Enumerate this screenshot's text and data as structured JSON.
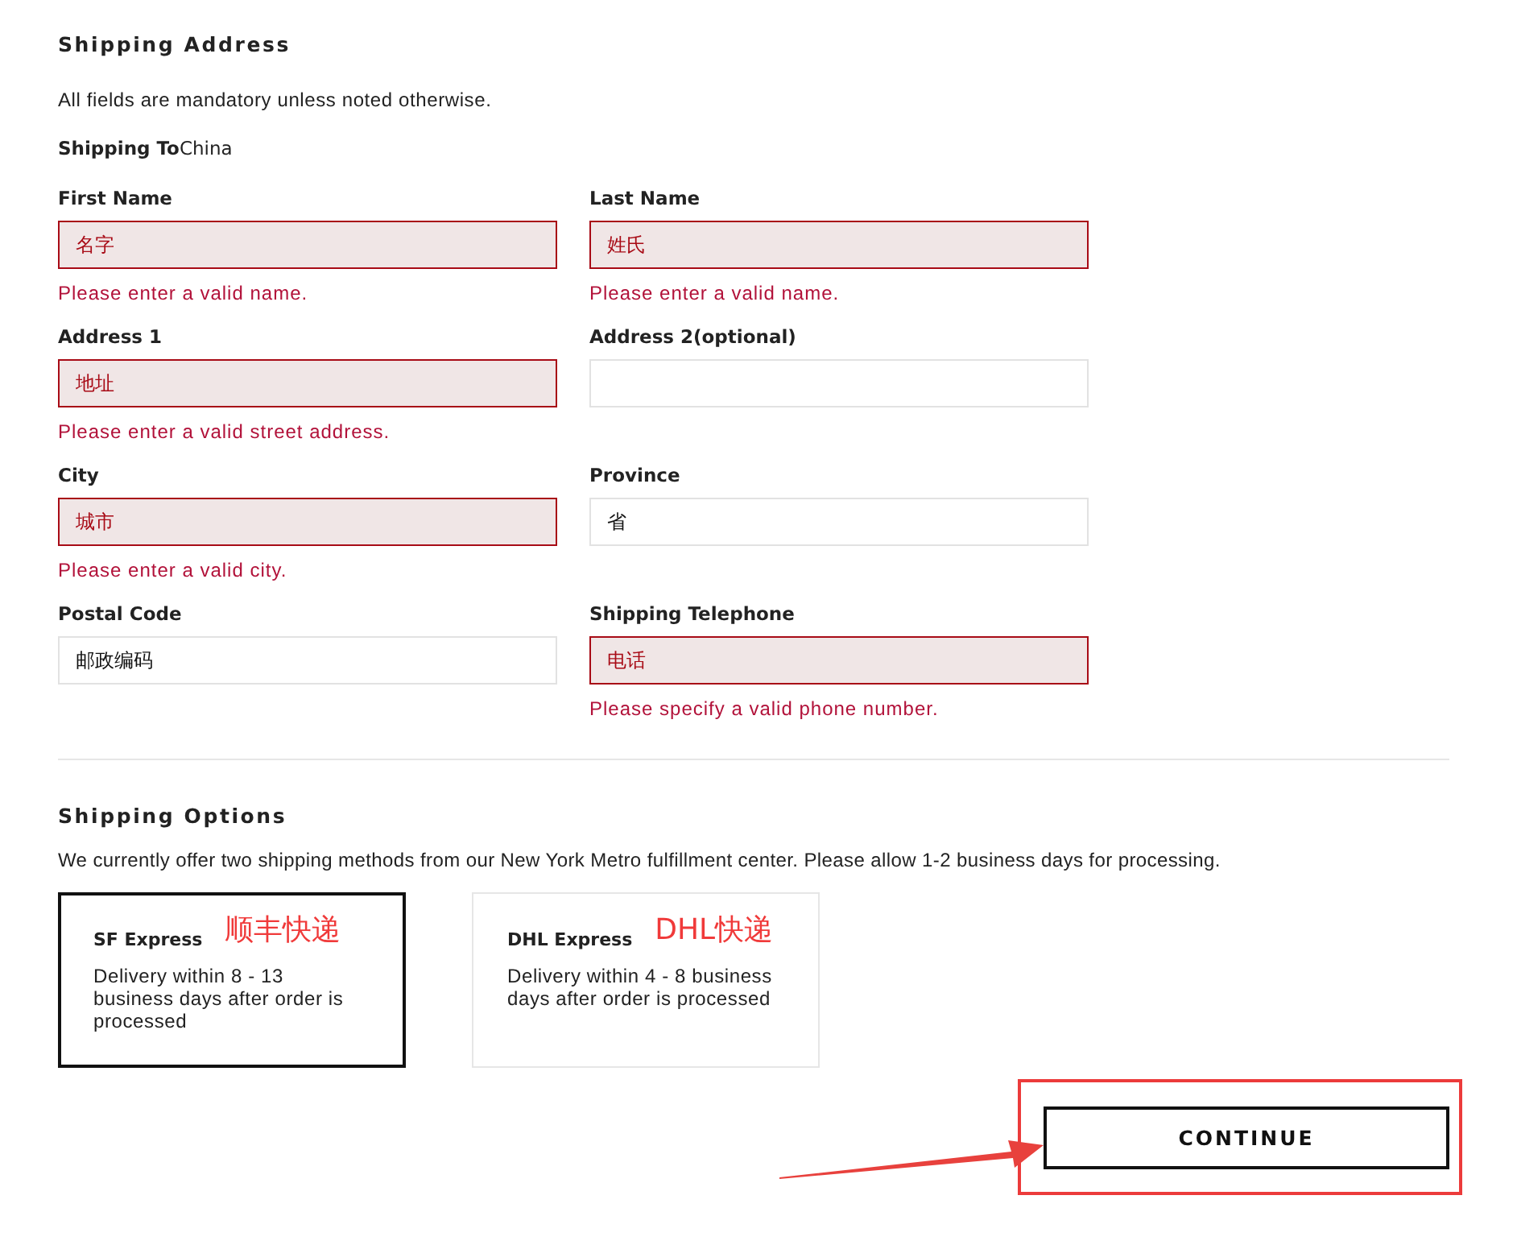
{
  "shipping_address": {
    "title": "Shipping Address",
    "note": "All fields are mandatory unless noted otherwise.",
    "shipping_to_label": "Shipping To",
    "shipping_to_value": "China",
    "fields": [
      {
        "label": "First Name",
        "value": "名字",
        "invalid": true,
        "error": "Please enter a valid name."
      },
      {
        "label": "Last Name",
        "value": "姓氏",
        "invalid": true,
        "error": "Please enter a valid name."
      },
      {
        "label": "Address 1",
        "value": "地址",
        "invalid": true,
        "error": "Please enter a valid street address."
      },
      {
        "label": "Address 2(optional)",
        "invalid": false
      },
      {
        "label": "City",
        "value": "城市",
        "invalid": true,
        "error": "Please enter a valid city."
      },
      {
        "label": "Province",
        "value": "省",
        "invalid": false
      },
      {
        "label": "Postal Code",
        "value": "邮政编码",
        "invalid": false
      },
      {
        "label": "Shipping Telephone",
        "value": "电话",
        "invalid": true,
        "error": "Please specify a valid phone number."
      }
    ]
  },
  "shipping_options": {
    "title": "Shipping Options",
    "description": "We currently offer two shipping methods from our New York Metro fulfillment center. Please allow 1-2 business days for processing.",
    "options": [
      {
        "name": "SF Express",
        "annotation": "顺丰快递",
        "details": "Delivery within 8 - 13 business days after order is processed",
        "selected": true
      },
      {
        "name": "DHL Express",
        "annotation": "DHL快递",
        "details": "Delivery within 4 - 8 business days after order is processed",
        "selected": false
      }
    ]
  },
  "continue_button": {
    "label": "CONTINUE",
    "highlighted": true
  }
}
